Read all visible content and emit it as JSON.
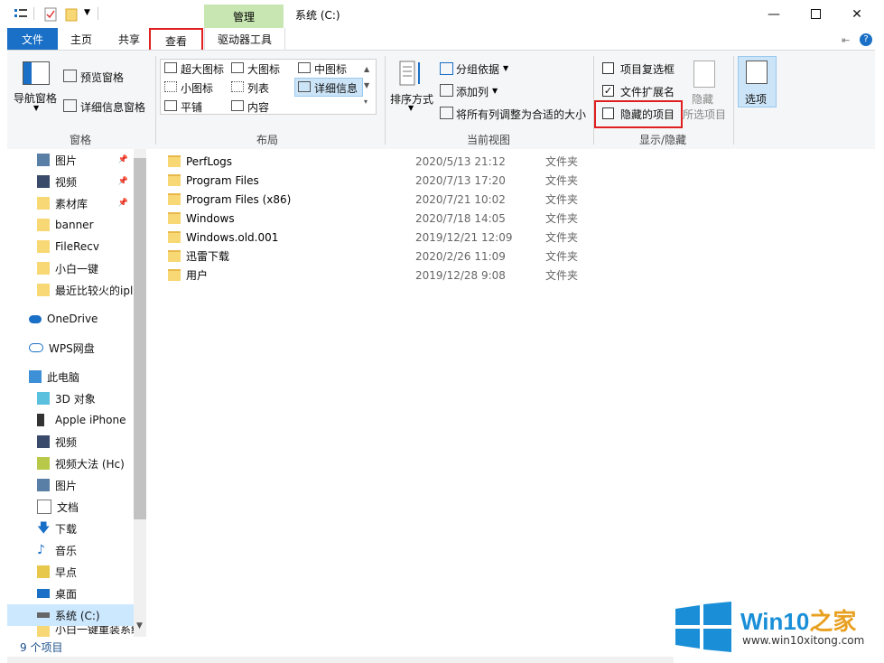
{
  "titlebar": {
    "context_tab": "管理",
    "title": "系统 (C:)"
  },
  "tabs": {
    "file": "文件",
    "home": "主页",
    "share": "共享",
    "view": "查看",
    "drive_tools": "驱动器工具"
  },
  "ribbon": {
    "pane": {
      "nav_pane": "导航窗格",
      "preview_pane": "预览窗格",
      "details_pane": "详细信息窗格",
      "group": "窗格"
    },
    "layout": {
      "xl_icons": "超大图标",
      "large_icons": "大图标",
      "medium_icons": "中图标",
      "small_icons": "小图标",
      "list": "列表",
      "details": "详细信息",
      "tiles": "平铺",
      "content": "内容",
      "group": "布局"
    },
    "current_view": {
      "sort_by": "排序方式",
      "group_by": "分组依据",
      "add_column": "添加列",
      "fit_columns": "将所有列调整为合适的大小",
      "group": "当前视图"
    },
    "show_hide": {
      "item_checkboxes": "项目复选框",
      "file_extensions": "文件扩展名",
      "hidden_items": "隐藏的项目",
      "hide_selected_1": "隐藏",
      "hide_selected_2": "所选项目",
      "group": "显示/隐藏"
    },
    "options": "选项"
  },
  "sidebar": {
    "items": [
      "图片",
      "视频",
      "素材库",
      "banner",
      "FileRecv",
      "小白一键",
      "最近比较火的ipl",
      "OneDrive",
      "WPS网盘",
      "此电脑",
      "3D 对象",
      "Apple iPhone",
      "视频",
      "视频大法 (Hc)",
      "图片",
      "文档",
      "下载",
      "音乐",
      "早点",
      "桌面",
      "系统 (C:)",
      "小白一键重装系统"
    ]
  },
  "files": [
    {
      "name": "PerfLogs",
      "date": "2020/5/13 21:12",
      "type": "文件夹"
    },
    {
      "name": "Program Files",
      "date": "2020/7/13 17:20",
      "type": "文件夹"
    },
    {
      "name": "Program Files (x86)",
      "date": "2020/7/21 10:02",
      "type": "文件夹"
    },
    {
      "name": "Windows",
      "date": "2020/7/18 14:05",
      "type": "文件夹"
    },
    {
      "name": "Windows.old.001",
      "date": "2019/12/21 12:09",
      "type": "文件夹"
    },
    {
      "name": "迅雷下载",
      "date": "2020/2/26 11:09",
      "type": "文件夹"
    },
    {
      "name": "用户",
      "date": "2019/12/28 9:08",
      "type": "文件夹"
    }
  ],
  "status": {
    "count": "9 个项目"
  },
  "watermark": {
    "brand": "Win10",
    "brand_cn": "之家",
    "url": "www.win10xitong.com"
  },
  "colors": {
    "file_tab": "#1a6fc6",
    "context_tab": "#c8e6b2",
    "highlight": "#e02020",
    "folder": "#f8d775",
    "logo_blue": "#1a8fd8"
  }
}
